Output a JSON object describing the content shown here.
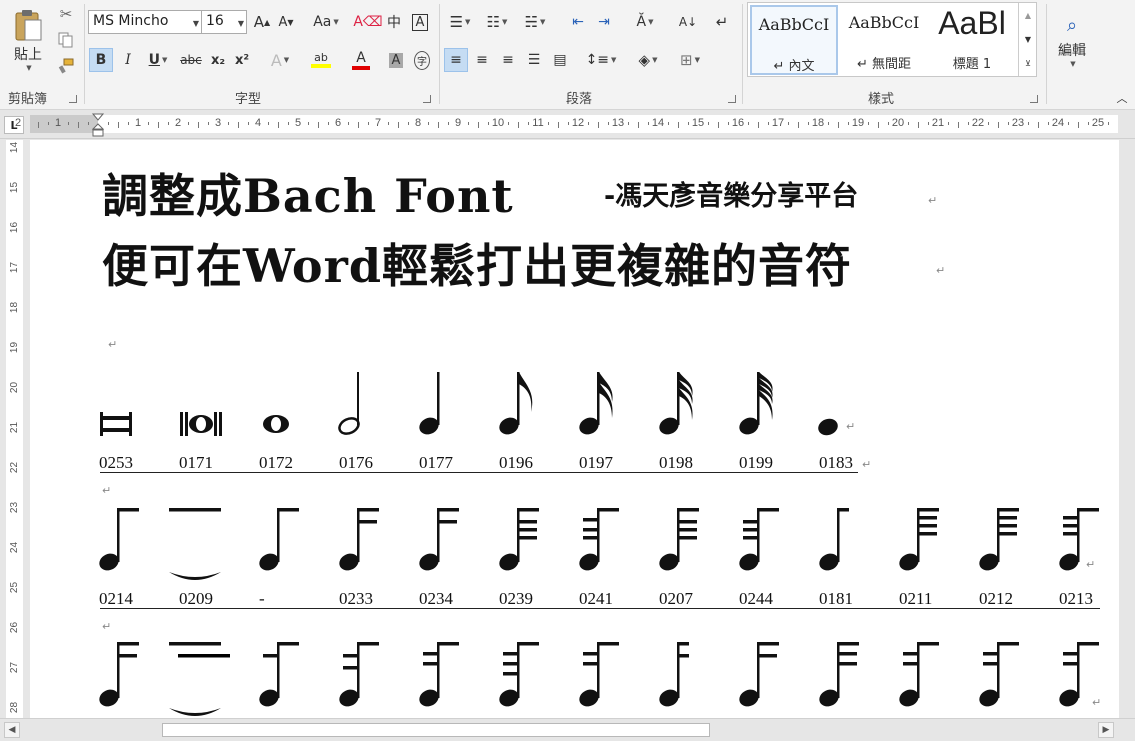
{
  "ribbon": {
    "clipboard": {
      "paste_label": "貼上",
      "group_label": "剪貼簿"
    },
    "font": {
      "group_label": "字型",
      "font_name": "MS Mincho",
      "font_size": "16",
      "grow_label": "A",
      "shrink_label": "A",
      "case_label": "Aa",
      "phonetic_label": "中",
      "border_char_label": "A",
      "bold_label": "B",
      "italic_label": "I",
      "underline_label": "U",
      "strike_label": "abc",
      "sub_label": "x₂",
      "sup_label": "x²",
      "effects_label": "A",
      "highlight_label": "ab",
      "color_label": "A",
      "shade_label": "A",
      "enclose_label": "字",
      "highlight_color": "#ffff00",
      "font_color": "#e00000"
    },
    "paragraph": {
      "group_label": "段落"
    },
    "styles": {
      "group_label": "樣式",
      "items": [
        {
          "preview": "AaBbCcI",
          "name": "內文"
        },
        {
          "preview": "AaBbCcI",
          "name": "無間距"
        },
        {
          "preview": "AaBl",
          "name": "標題 1"
        }
      ]
    },
    "editing": {
      "label": "編輯"
    }
  },
  "ruler": {
    "corner": "L",
    "h_numbers": [
      "2",
      "1",
      "1",
      "2",
      "3",
      "4",
      "5",
      "6",
      "7",
      "8",
      "9",
      "10",
      "11",
      "12",
      "13",
      "14",
      "15",
      "16",
      "17",
      "18",
      "19",
      "20",
      "21",
      "22",
      "23",
      "24",
      "25"
    ],
    "v_numbers": [
      "14",
      "15",
      "16",
      "17",
      "18",
      "19",
      "20",
      "21",
      "22",
      "23",
      "24",
      "25",
      "26",
      "27",
      "28"
    ]
  },
  "document": {
    "title_line1": "調整成Bach Font",
    "subtitle": "-馮天彥音樂分享平台",
    "title_line2": "便可在Word輕鬆打出更複雜的音符",
    "para_mark": "↵",
    "row1_codes": [
      "0253",
      "0171",
      "0172",
      "0176",
      "0177",
      "0196",
      "0197",
      "0198",
      "0199",
      "0183"
    ],
    "row2_codes": [
      "0214",
      "0209",
      "-",
      "0233",
      "0234",
      "0239",
      "0241",
      "0207",
      "0244",
      "0181",
      "0211",
      "0212",
      "0213"
    ]
  }
}
